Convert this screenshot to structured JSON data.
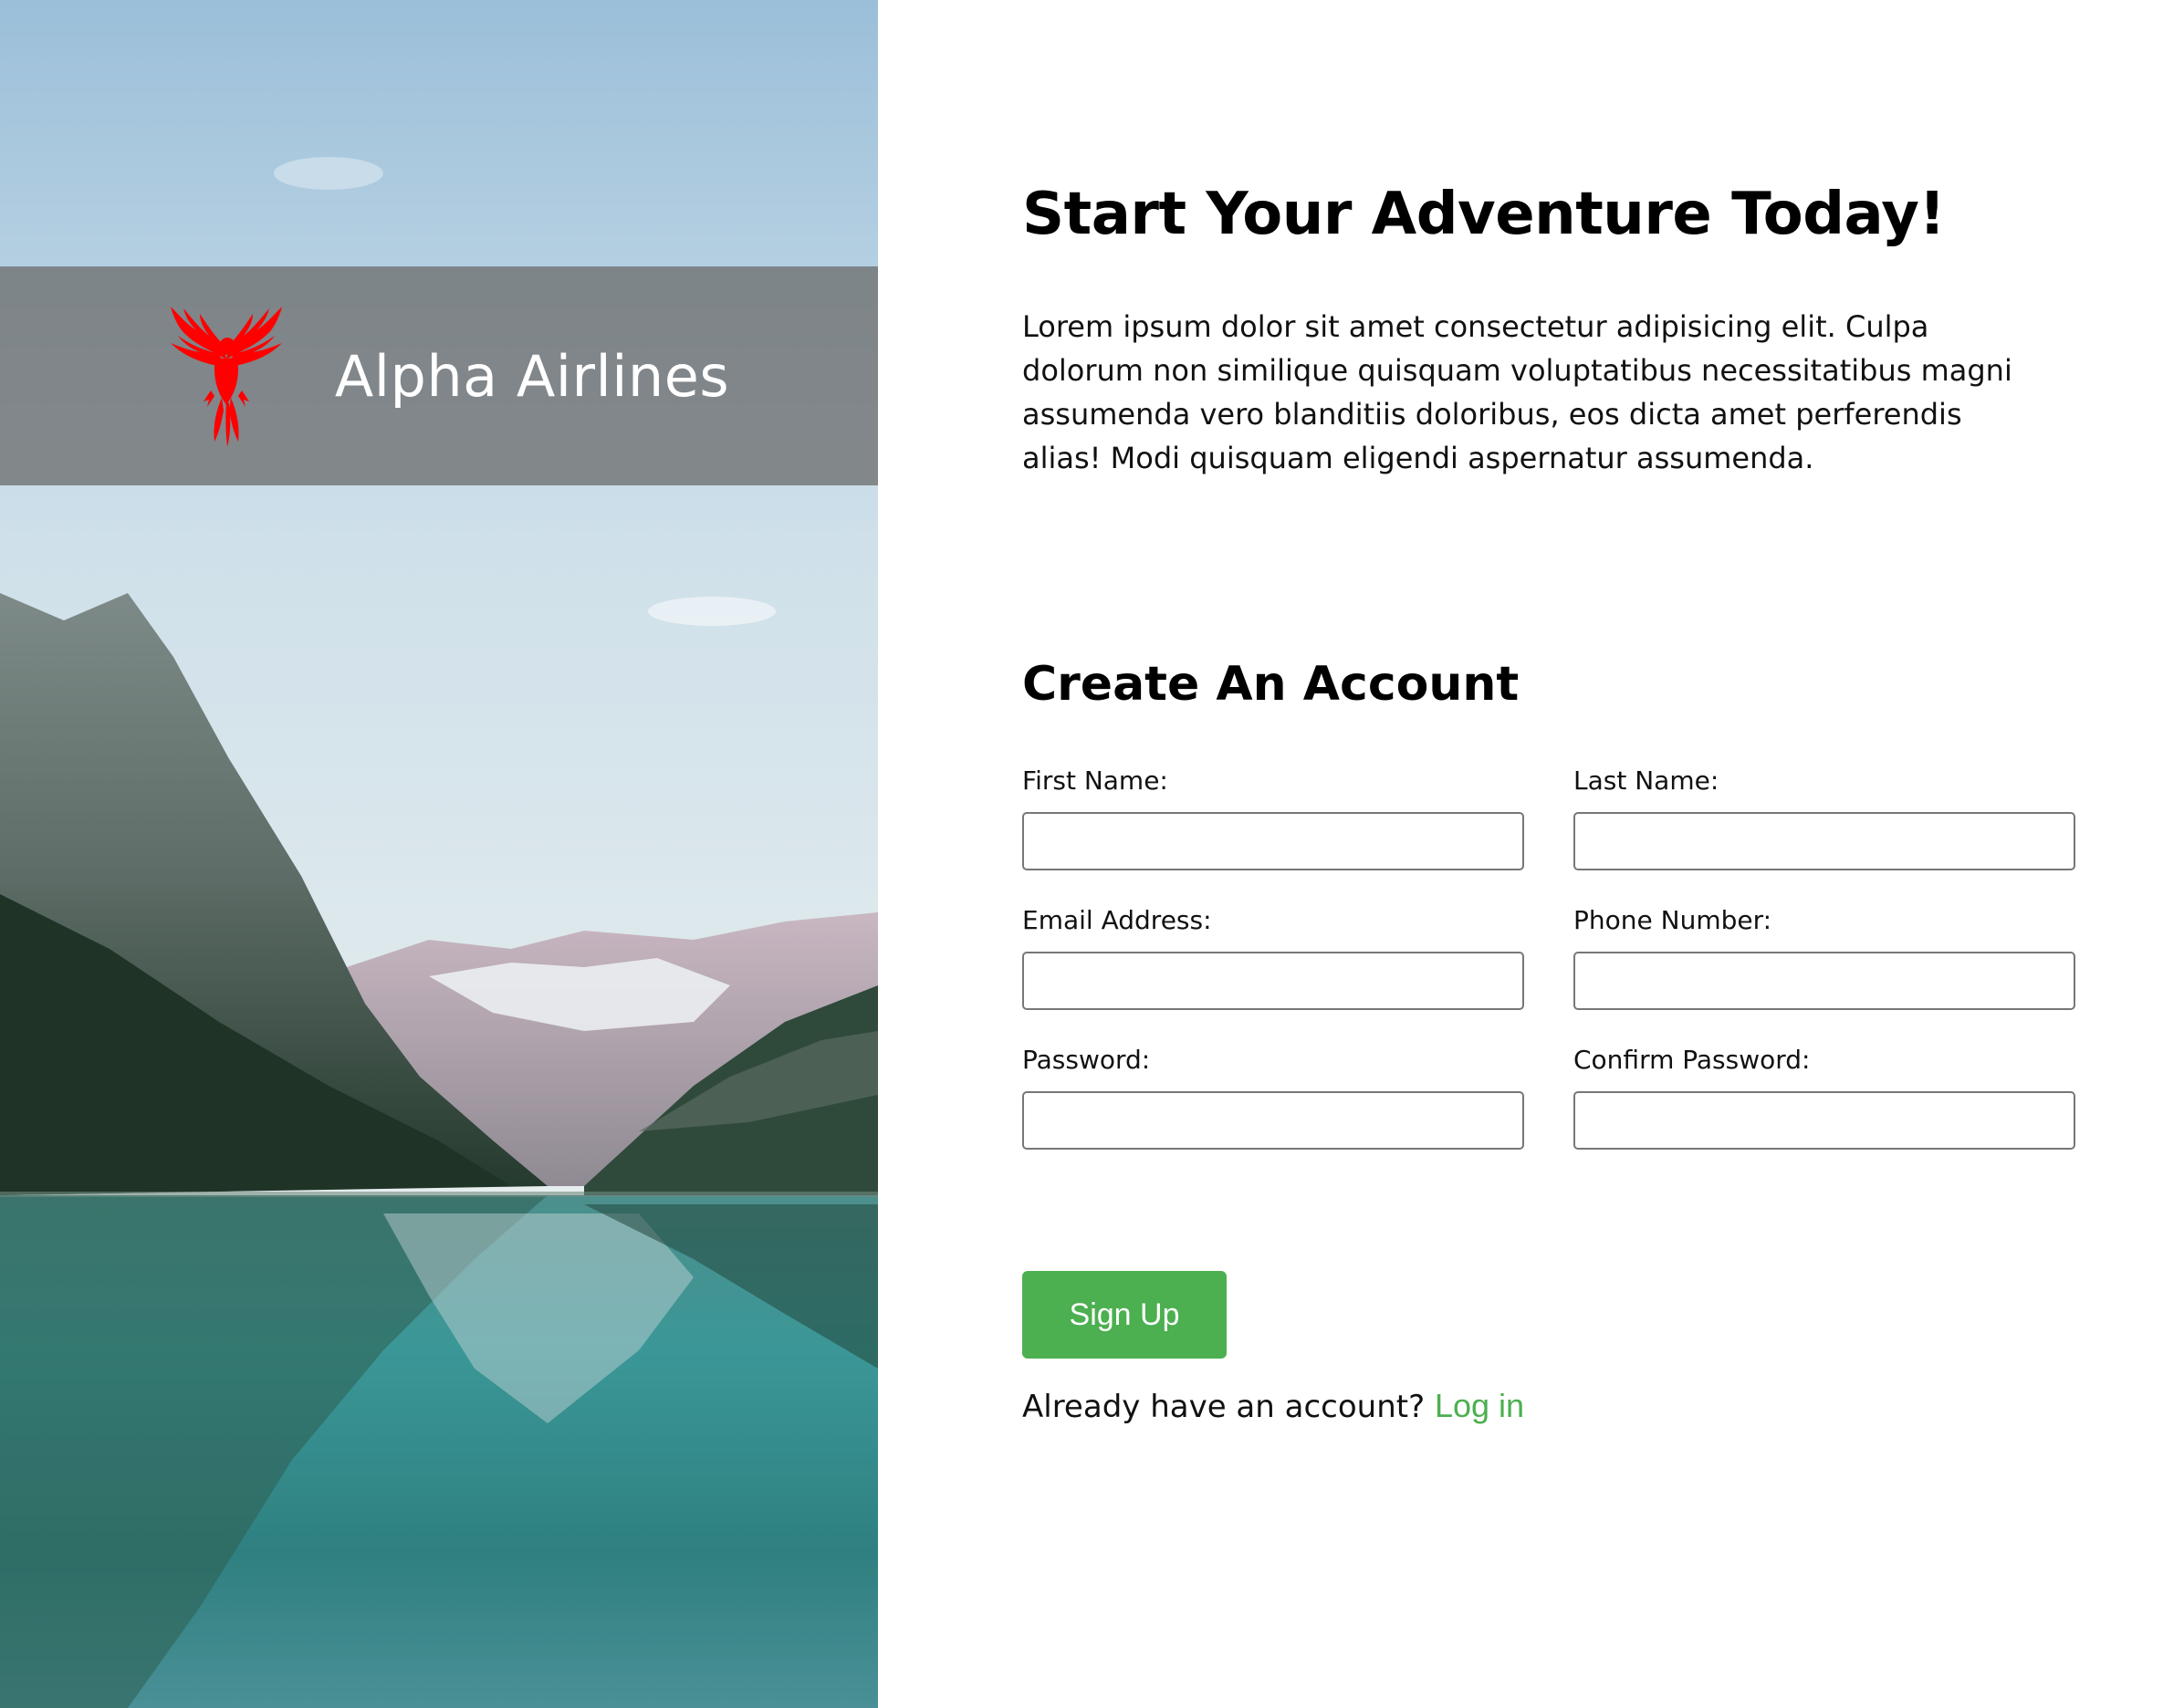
{
  "brand": {
    "name": "Alpha Airlines",
    "logo_icon": "phoenix-icon",
    "logo_color": "#ff0000"
  },
  "hero": {
    "image": "mountain-lake-photo"
  },
  "main": {
    "headline": "Start Your Adventure Today!",
    "intro": "Lorem ipsum dolor sit amet consectetur adipisicing elit. Culpa dolorum non similique quisquam voluptatibus necessitatibus magni assumenda vero blanditiis doloribus, eos dicta amet perferendis alias! Modi quisquam eligendi aspernatur assumenda."
  },
  "form": {
    "title": "Create An Account",
    "fields": {
      "first_name": {
        "label": "First Name:",
        "value": "",
        "placeholder": ""
      },
      "last_name": {
        "label": "Last Name:",
        "value": "",
        "placeholder": ""
      },
      "email": {
        "label": "Email Address:",
        "value": "",
        "placeholder": ""
      },
      "phone": {
        "label": "Phone Number:",
        "value": "",
        "placeholder": ""
      },
      "password": {
        "label": "Password:",
        "value": "",
        "placeholder": ""
      },
      "confirm_password": {
        "label": "Confirm Password:",
        "value": "",
        "placeholder": ""
      }
    },
    "submit_label": "Sign Up",
    "login_prompt": "Already have an account?",
    "login_link": "Log in"
  },
  "colors": {
    "accent": "#4caf50",
    "logo": "#ff0000",
    "brand_bar": "#6e7070"
  }
}
